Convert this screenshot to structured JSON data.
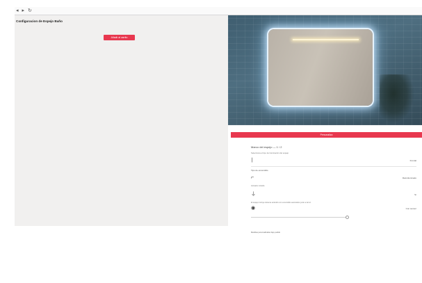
{
  "toolbar": {
    "back_icon": "back-arrow-icon",
    "forward_icon": "forward-arrow-icon",
    "refresh_icon": "refresh-icon"
  },
  "config": {
    "title": "Configuracion de Espejo Baño",
    "cta_label": "Añadir al carrito"
  },
  "hero": {
    "image_subject": "backlit-mirror"
  },
  "panel": {
    "bar_label": "Personaliza",
    "option_title": "Marco del espejo — 1 / 2",
    "option_desc": "Selecciona el tipo de iluminación del espejo",
    "rows": [
      {
        "icon": "light-icon",
        "value": "Frontal"
      },
      {
        "icon": "faucet-icon",
        "value": "Retroiluminado"
      },
      {
        "icon": "plug-icon",
        "value": "Sí"
      },
      {
        "icon": "sensor-icon",
        "value": "Con sensor"
      }
    ],
    "section_label": "Tipo de encendido",
    "sub_label": "Antivaho incluido",
    "note": "El espejo incluye sistema antivaho con encendido automático junto a la luz.",
    "footnote": "Medidas personalizadas bajo pedido"
  },
  "colors": {
    "accent": "#e8384f",
    "pane_bg": "#f1f0ef",
    "hero_bg": "#4e6e80"
  }
}
